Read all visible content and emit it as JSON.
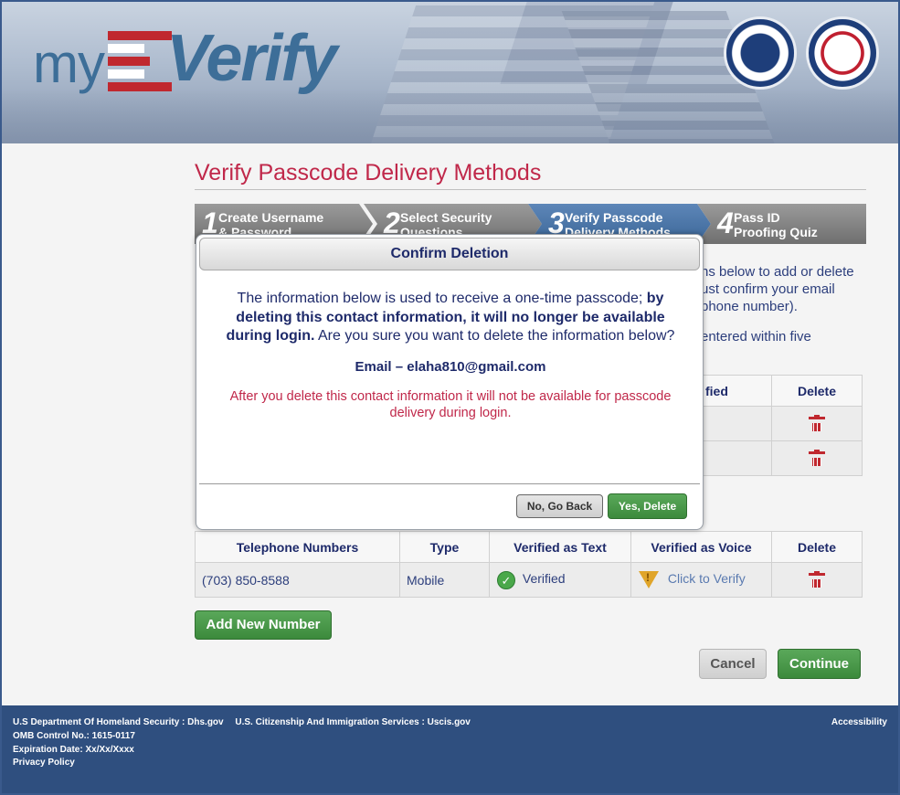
{
  "header": {
    "logo_my": "my",
    "logo_verify": "Verify",
    "seal_dhs": "U.S. DEPARTMENT OF HOMELAND SECURITY",
    "seal_ssa": "SOCIAL SECURITY ADMINISTRATION"
  },
  "page": {
    "title": "Verify Passcode Delivery Methods"
  },
  "steps": [
    {
      "number": "1",
      "label_line1": "Create Username",
      "label_line2": "& Password",
      "state": "completed"
    },
    {
      "number": "2",
      "label_line1": "Select Security",
      "label_line2": "Questions",
      "state": "completed"
    },
    {
      "number": "3",
      "label_line1": "Verify Passcode",
      "label_line2": "Delivery Methods",
      "state": "active"
    },
    {
      "number": "4",
      "label_line1": "Pass ID",
      "label_line2": "Proofing Quiz",
      "state": "pending"
    }
  ],
  "background_text": {
    "line1": "ns below to add or delete",
    "line2": "ust confirm your email",
    "line3": "phone number).",
    "line4": "entered within five"
  },
  "email_table": {
    "col_verified_partial": "fied",
    "col_delete": "Delete"
  },
  "phone_table": {
    "headers": [
      "Telephone Numbers",
      "Type",
      "Verified as Text",
      "Verified as Voice",
      "Delete"
    ],
    "rows": [
      {
        "number": "(703) 850-8588",
        "type": "Mobile",
        "text_status": "Verified",
        "voice_status": "Click to Verify"
      }
    ]
  },
  "buttons": {
    "add_number": "Add New Number",
    "cancel": "Cancel",
    "continue": "Continue"
  },
  "modal": {
    "title": "Confirm Deletion",
    "body_plain_1": "The information below is used to receive a one-time passcode; ",
    "body_bold": "by deleting this contact information, it will no longer be available during login.",
    "body_plain_2": " Are you sure you want to delete the information below?",
    "email_line": "Email – elaha810@gmail.com",
    "warning": "After you delete this contact information it will not be available for passcode delivery during login.",
    "btn_no": "No, Go Back",
    "btn_yes": "Yes, Delete"
  },
  "footer": {
    "dhs": "U.S Department Of Homeland Security : Dhs.gov",
    "uscis": "U.S. Citizenship And Immigration Services : Uscis.gov",
    "omb": "OMB Control No.: 1615-0117",
    "expiration": "Expiration Date: Xx/Xx/Xxxx",
    "privacy": "Privacy Policy",
    "accessibility": "Accessibility"
  },
  "colors": {
    "title_red": "#c0284a",
    "navy": "#1e2a6a",
    "green": "#3c8a3c",
    "footer_blue": "#2f4f7f",
    "active_step": "#3b6697"
  }
}
